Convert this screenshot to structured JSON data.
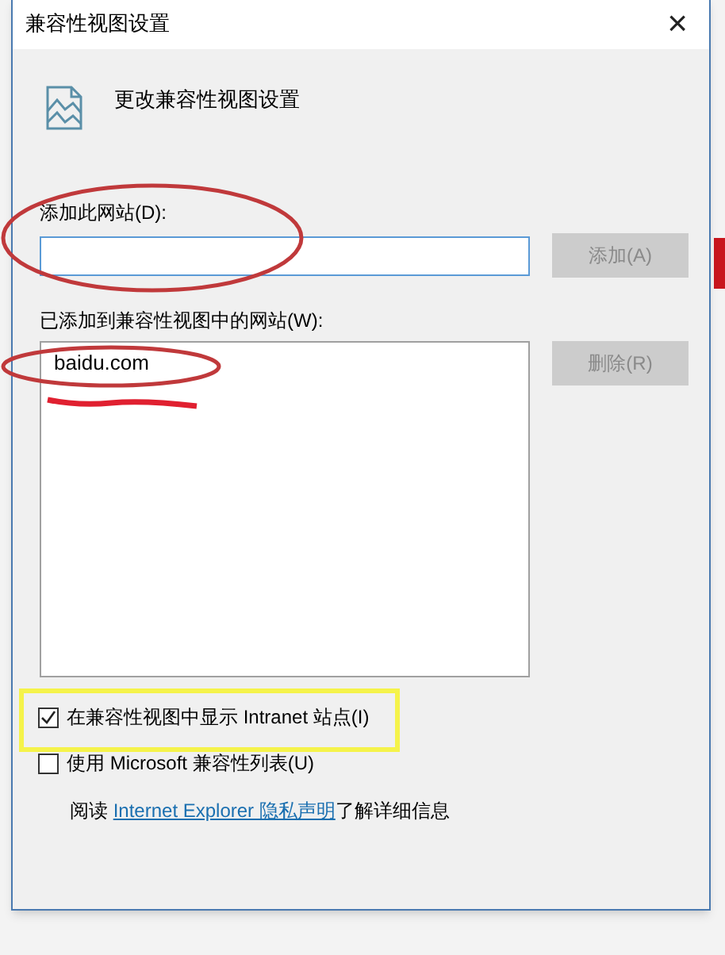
{
  "window": {
    "title": "兼容性视图设置",
    "close": "×"
  },
  "heading": "更改兼容性视图设置",
  "add_site": {
    "label": "添加此网站(D):",
    "button": {
      "label": "添加(A)",
      "disabled": true
    }
  },
  "site_list": {
    "label": "已添加到兼容性视图中的网站(W):",
    "items": [
      {
        "text": "baidu.com",
        "selected": false
      }
    ],
    "button": {
      "label": "删除(R)",
      "disabled": true
    }
  },
  "options": [
    {
      "label": "在兼容性视图中显示 Intranet 站点(I)",
      "checked": true
    },
    {
      "label": "使用 Microsoft 兼容性列表(U)",
      "checked": false
    }
  ],
  "privacy": {
    "before": "阅读 ",
    "link": "Internet Explorer 隐私声明",
    "after": "了解详细信息"
  }
}
